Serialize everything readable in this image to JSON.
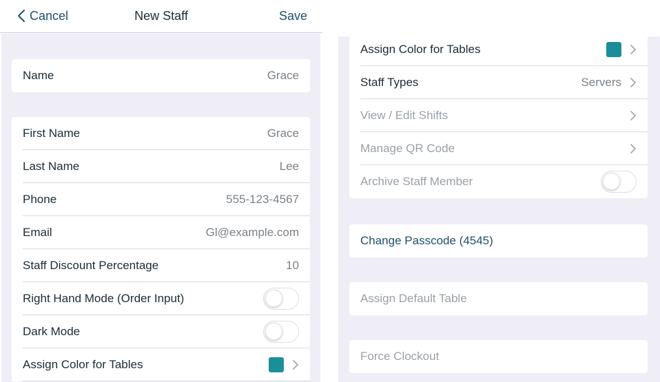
{
  "nav": {
    "back_label": "Cancel",
    "title": "New Staff",
    "save_label": "Save"
  },
  "left": {
    "name_group": {
      "label": "Name",
      "value": "Grace"
    },
    "details": [
      {
        "label": "First Name",
        "value": "Grace"
      },
      {
        "label": "Last Name",
        "value": "Lee"
      },
      {
        "label": "Phone",
        "value": "555-123-4567"
      },
      {
        "label": "Email",
        "value": "Gl@example.com"
      },
      {
        "label": "Staff Discount Percentage",
        "value": "10"
      }
    ],
    "toggles": [
      {
        "label": "Right Hand Mode (Order Input)",
        "on": false
      },
      {
        "label": "Dark Mode",
        "on": false
      }
    ],
    "assign_color": {
      "label": "Assign Color for Tables",
      "color": "#1a8f99"
    }
  },
  "right": {
    "assign_color": {
      "label": "Assign Color for Tables",
      "color": "#1a8f99"
    },
    "staff_types": {
      "label": "Staff Types",
      "value": "Servers"
    },
    "view_shifts": {
      "label": "View / Edit Shifts"
    },
    "manage_qr": {
      "label": "Manage QR Code"
    },
    "archive": {
      "label": "Archive Staff Member",
      "on": false
    },
    "change_passcode": {
      "label": "Change Passcode (4545)"
    },
    "assign_default_table": {
      "label": "Assign Default Table"
    },
    "force_clockout": {
      "label": "Force Clockout"
    }
  },
  "colors": {
    "accent": "#1d4f6e",
    "swatch": "#1a8f99",
    "group_bg": "#efeef6"
  },
  "icons": {
    "back": "chevron-left-icon",
    "disclosure": "chevron-right-icon"
  }
}
